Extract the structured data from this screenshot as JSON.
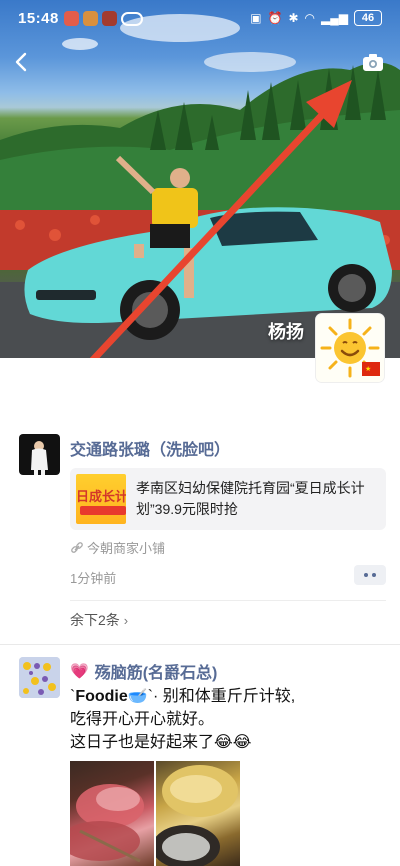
{
  "status_bar": {
    "time": "15:48",
    "battery": "46",
    "notification_icon_colors": [
      "#e35d4b",
      "#d9903f",
      "#a33b2f"
    ]
  },
  "cover": {
    "username": "杨扬",
    "annotation_color": "#e8452f"
  },
  "post1": {
    "author": "交通路张璐（洗脸吧）",
    "link_title": "孝南区妇幼保健院托育园“夏日成长计划”39.9元限时抢",
    "thumb_text": "日成长计",
    "source": "今朝商家小铺",
    "time": "1分钟前",
    "more_comments": "余下2条"
  },
  "post2": {
    "author": "殇脑筋(名爵石总)",
    "text_line1_prefix": "`",
    "text_line1_bold": "Foodie",
    "text_line1_suffix": "🥣`· 别和体重斤斤计较,",
    "text_line2": "吃得开心开心就好。",
    "text_line3": "这日子也是好起来了😂😂"
  },
  "colors": {
    "author_link": "#576b95",
    "meta_gray": "#999999"
  }
}
